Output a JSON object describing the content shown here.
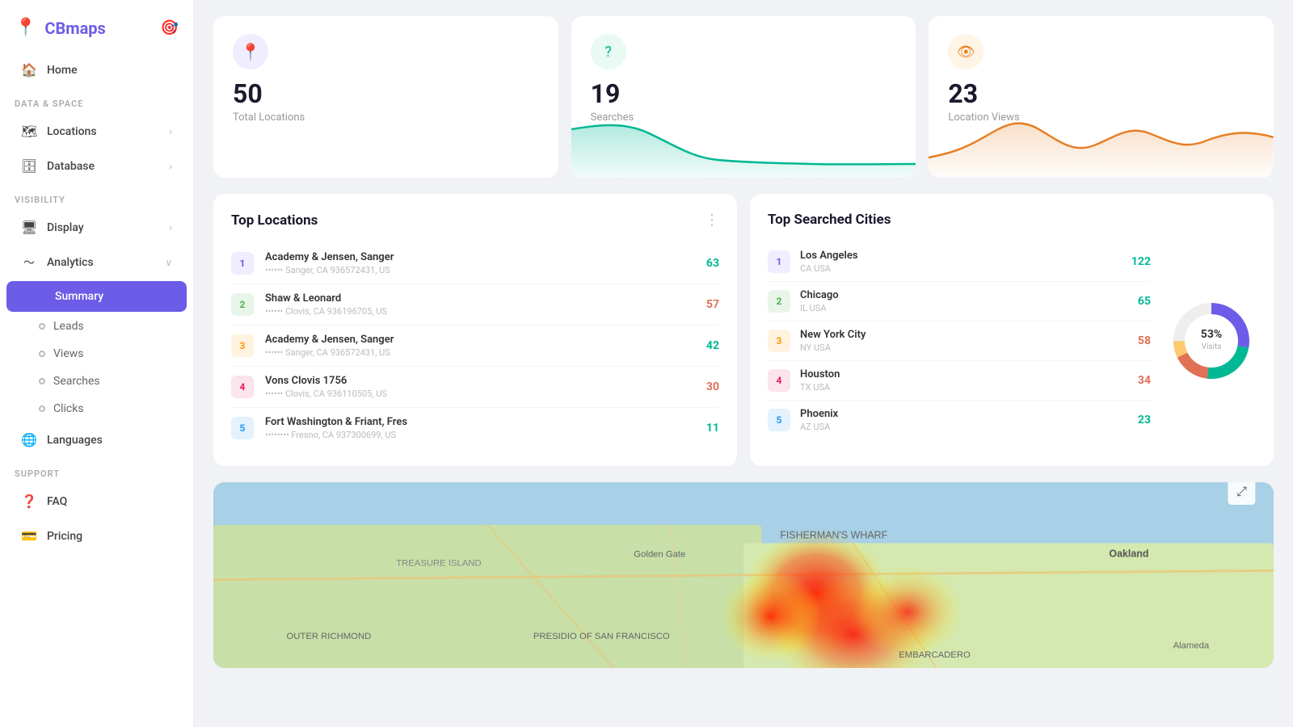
{
  "sidebar": {
    "logo_text": "CBmaps",
    "sections": [
      {
        "label": null,
        "items": [
          {
            "id": "home",
            "icon": "🏠",
            "label": "Home",
            "hasChevron": false,
            "active": false
          }
        ]
      },
      {
        "label": "DATA & SPACE",
        "items": [
          {
            "id": "locations",
            "icon": "🗺",
            "label": "Locations",
            "hasChevron": true,
            "active": false
          },
          {
            "id": "database",
            "icon": "🗄",
            "label": "Database",
            "hasChevron": true,
            "active": false
          }
        ]
      },
      {
        "label": "VISIBILITY",
        "items": [
          {
            "id": "display",
            "icon": "🖥",
            "label": "Display",
            "hasChevron": true,
            "active": false
          },
          {
            "id": "analytics",
            "icon": "📈",
            "label": "Analytics",
            "hasChevron": true,
            "active": false
          }
        ]
      }
    ],
    "sub_items": [
      {
        "id": "summary",
        "label": "Summary",
        "active": true
      },
      {
        "id": "leads",
        "label": "Leads",
        "active": false
      },
      {
        "id": "views",
        "label": "Views",
        "active": false
      },
      {
        "id": "searches",
        "label": "Searches",
        "active": false
      },
      {
        "id": "clicks",
        "label": "Clicks",
        "active": false
      },
      {
        "id": "languages",
        "label": "Languages",
        "icon": "🌐",
        "active": false
      }
    ],
    "support_label": "SUPPORT",
    "support_items": [
      {
        "id": "faq",
        "icon": "❓",
        "label": "FAQ"
      },
      {
        "id": "pricing",
        "icon": "💳",
        "label": "Pricing"
      }
    ]
  },
  "stats": [
    {
      "id": "total-locations",
      "icon": "📍",
      "icon_type": "purple",
      "number": "50",
      "label": "Total Locations",
      "chart_type": "none"
    },
    {
      "id": "searches",
      "icon": "❓",
      "icon_type": "green",
      "number": "19",
      "label": "Searches",
      "chart_type": "green_line"
    },
    {
      "id": "location-views",
      "icon": "👁",
      "icon_type": "orange",
      "number": "23",
      "label": "Location Views",
      "chart_type": "orange_line"
    }
  ],
  "top_locations": {
    "title": "Top Locations",
    "items": [
      {
        "rank": 1,
        "name": "Academy & Jensen, Sanger",
        "addr": "•••••• Sanger, CA 936572431, US",
        "count": "63",
        "color": "green"
      },
      {
        "rank": 2,
        "name": "Shaw & Leonard",
        "addr": "•••••• Clovis, CA 936196705, US",
        "count": "57",
        "color": "red"
      },
      {
        "rank": 3,
        "name": "Academy & Jensen, Sanger",
        "addr": "•••••• Sanger, CA 936572431, US",
        "count": "42",
        "color": "green"
      },
      {
        "rank": 4,
        "name": "Vons Clovis 1756",
        "addr": "•••••• Clovis, CA 936110505, US",
        "count": "30",
        "color": "red"
      },
      {
        "rank": 5,
        "name": "Fort Washington & Friant, Fres",
        "addr": "•••••••• Fresno, CA 937300699, US",
        "count": "11",
        "color": "green"
      }
    ]
  },
  "top_cities": {
    "title": "Top Searched Cities",
    "donut_percent": "53%",
    "donut_label": "Visits",
    "items": [
      {
        "rank": 1,
        "name": "Los Angeles",
        "sub": "CA USA",
        "count": "122",
        "color": "green"
      },
      {
        "rank": 2,
        "name": "Chicago",
        "sub": "IL USA",
        "count": "65",
        "color": "green"
      },
      {
        "rank": 3,
        "name": "New York City",
        "sub": "NY USA",
        "count": "58",
        "color": "red"
      },
      {
        "rank": 4,
        "name": "Houston",
        "sub": "TX USA",
        "count": "34",
        "color": "red"
      },
      {
        "rank": 5,
        "name": "Phoenix",
        "sub": "AZ USA",
        "count": "23",
        "color": "green"
      }
    ]
  },
  "map": {
    "label": "Heatmap"
  }
}
